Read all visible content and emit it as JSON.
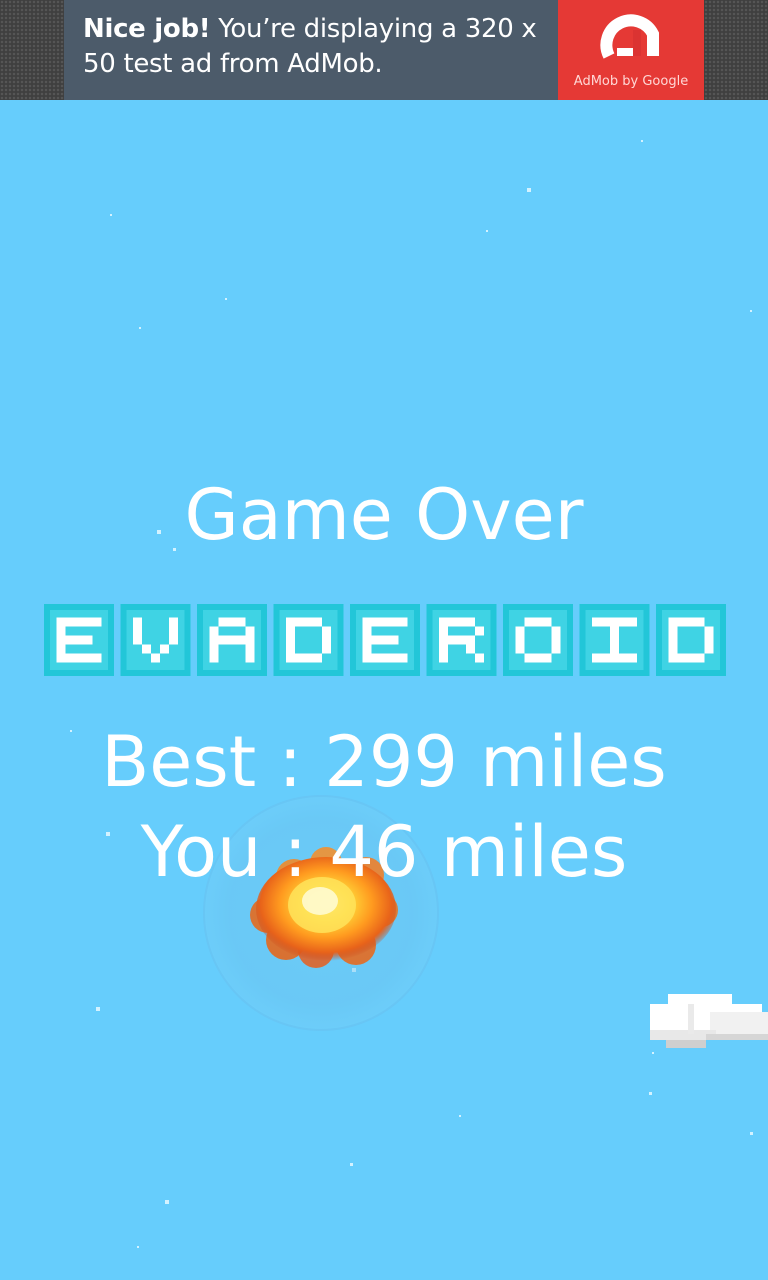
{
  "ad": {
    "headline": "Nice job!",
    "message": " You’re displaying a 320 x 50 test ad from AdMob.",
    "brand": "AdMob by Google",
    "colors": {
      "banner": "#4c5b6a",
      "logo_bg": "#e53935"
    }
  },
  "game": {
    "title": "Game Over",
    "logo_text": "EVADEROID",
    "best_line": "Best : 299 miles",
    "you_line": "You : 46 miles",
    "colors": {
      "sky": "#66cdfc",
      "logo_fill": "#ffffff",
      "logo_outline": "#22c6d8",
      "text": "#ffffff"
    },
    "icons": [
      "explosion-icon",
      "cloud-icon",
      "admob-logo-icon"
    ]
  }
}
